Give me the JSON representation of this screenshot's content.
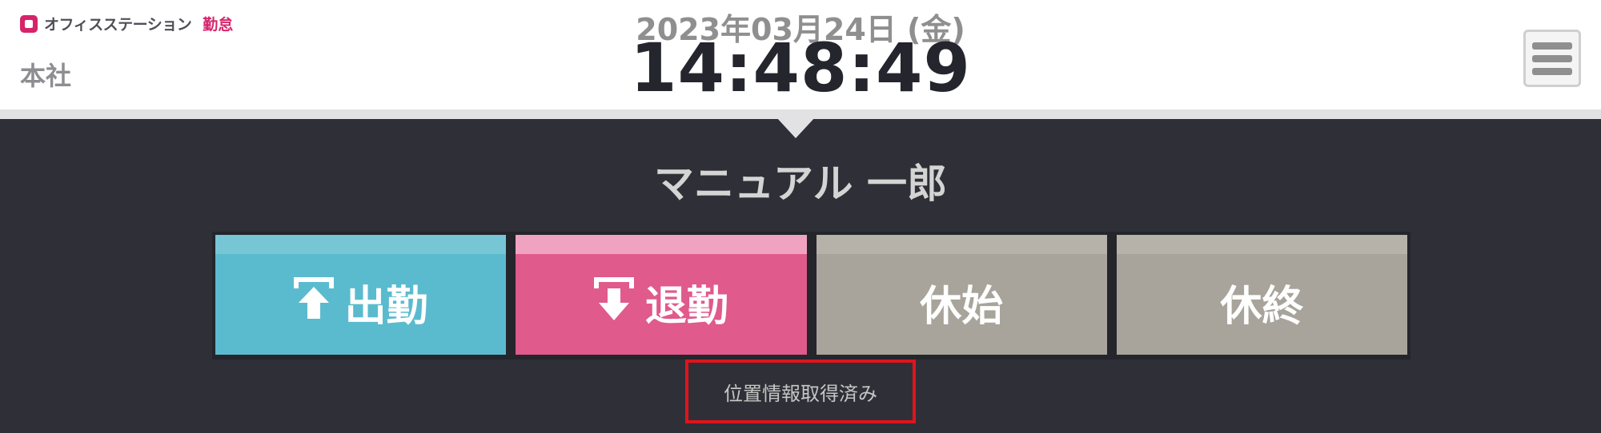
{
  "header": {
    "logo_text": "オフィスステーション",
    "logo_sub": "勤怠",
    "office": "本社",
    "date": "2023年03月24日 (金)",
    "time": "14:48:49",
    "menu_icon": "hamburger-icon"
  },
  "user": {
    "name": "マニュアル 一郎"
  },
  "stamps": [
    {
      "label": "出勤",
      "icon": "clock-in-arrow-up-icon",
      "color": "#5bbbce"
    },
    {
      "label": "退勤",
      "icon": "clock-out-arrow-down-icon",
      "color": "#e05a8c"
    },
    {
      "label": "休始",
      "color": "#a8a49b"
    },
    {
      "label": "休終",
      "color": "#a8a49b"
    }
  ],
  "location_status": "位置情報取得済み",
  "colors": {
    "brand": "#d6246b",
    "background": "#2f2f37",
    "highlight": "#e0141c"
  }
}
